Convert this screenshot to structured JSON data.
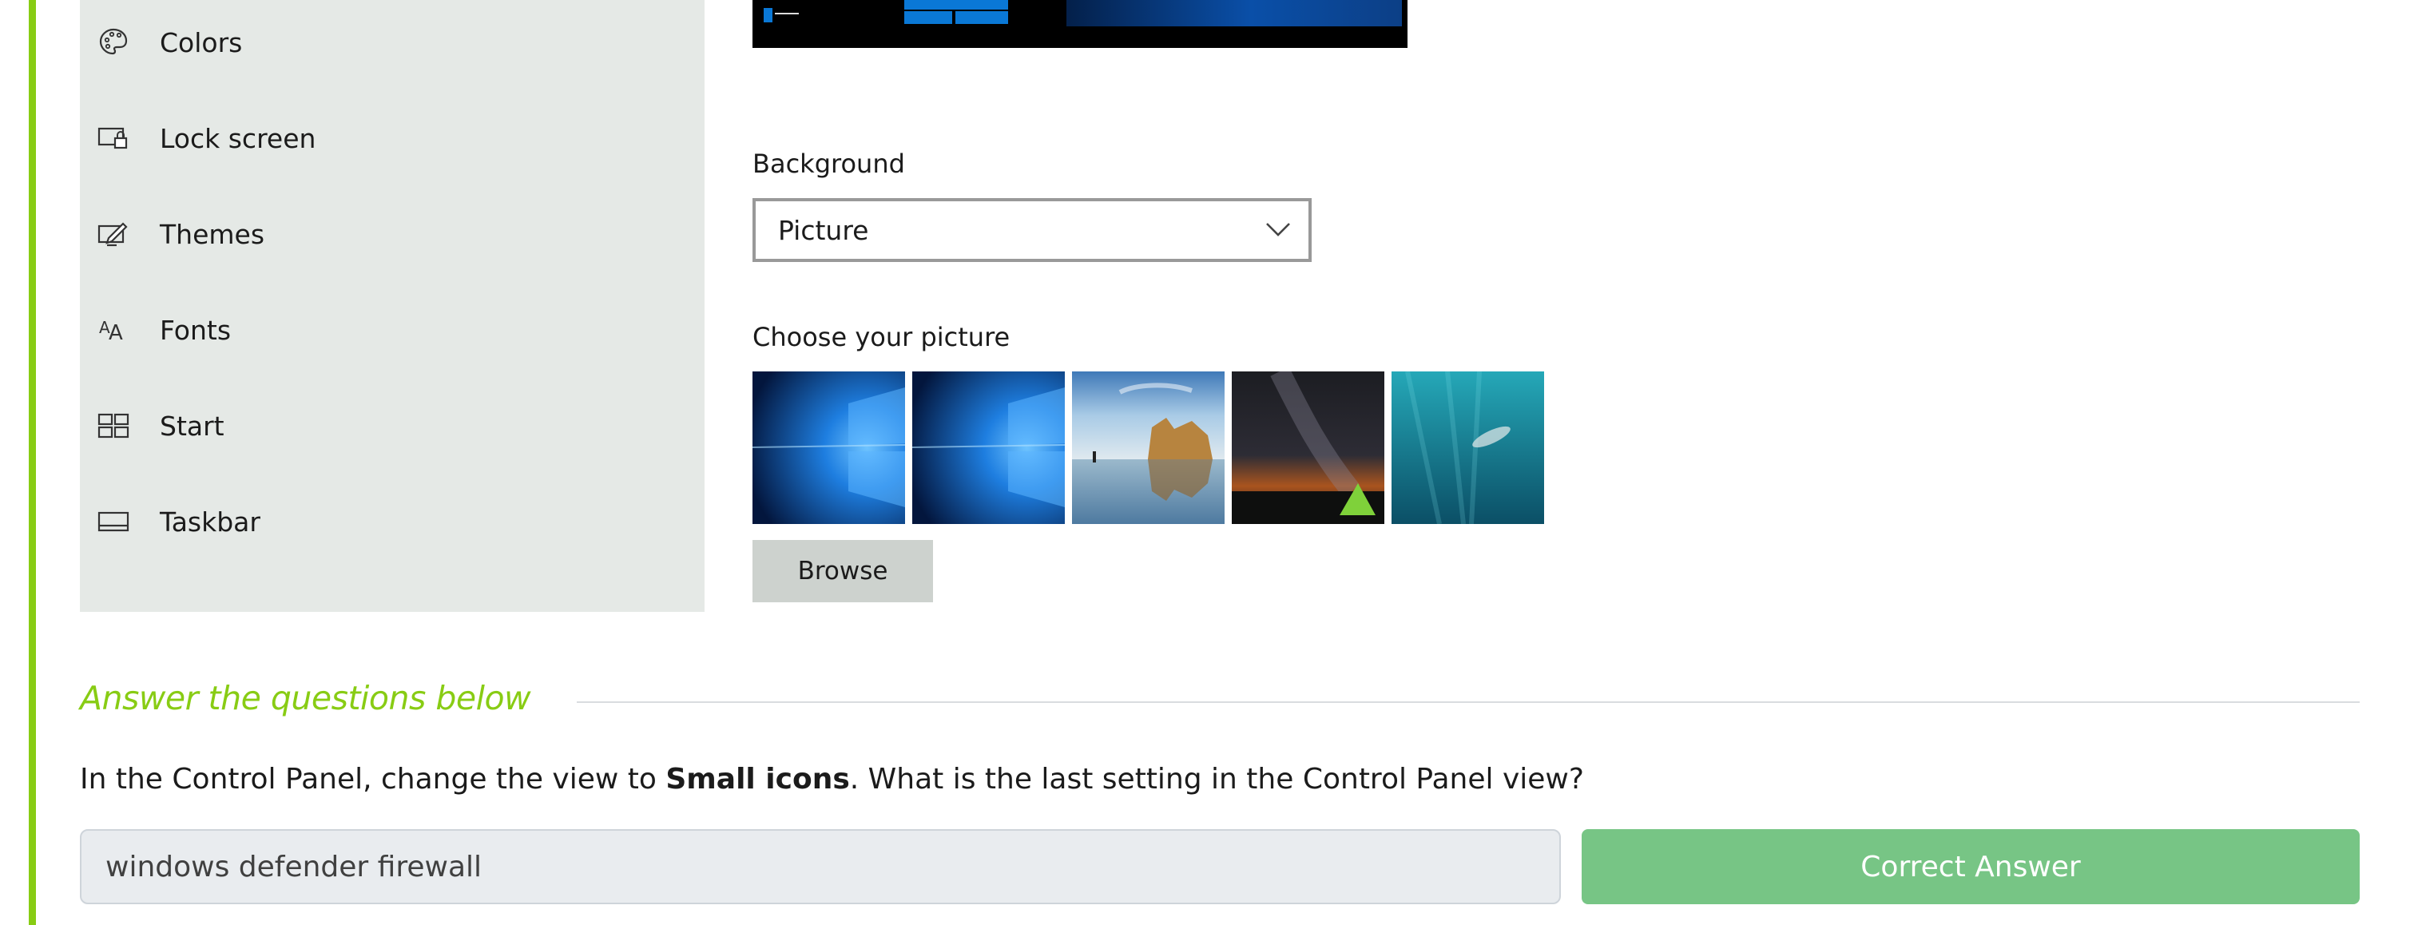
{
  "sidebar": {
    "items": [
      {
        "label": "Colors",
        "icon": "palette-icon"
      },
      {
        "label": "Lock screen",
        "icon": "lock-screen-icon"
      },
      {
        "label": "Themes",
        "icon": "themes-brush-icon"
      },
      {
        "label": "Fonts",
        "icon": "fonts-icon"
      },
      {
        "label": "Start",
        "icon": "start-tiles-icon"
      },
      {
        "label": "Taskbar",
        "icon": "taskbar-icon"
      }
    ]
  },
  "background": {
    "label": "Background",
    "selected": "Picture"
  },
  "picture": {
    "label": "Choose your picture",
    "thumbnails": [
      "windows-hero-blue",
      "windows-hero-blue",
      "beach-rocks-reflection",
      "milky-way-tent",
      "underwater-swimmer"
    ],
    "browse_label": "Browse"
  },
  "questions": {
    "heading": "Answer the questions below",
    "prompt_before": "In the Control Panel, change the view to ",
    "prompt_bold": "Small icons",
    "prompt_after": ". What is the last setting in the Control Panel view?",
    "answer_value": "windows defender firewall",
    "button_label": "Correct Answer"
  },
  "colors": {
    "accent": "#88cc14",
    "sidebar_bg": "#e5e9e6",
    "correct": "#77c585"
  }
}
